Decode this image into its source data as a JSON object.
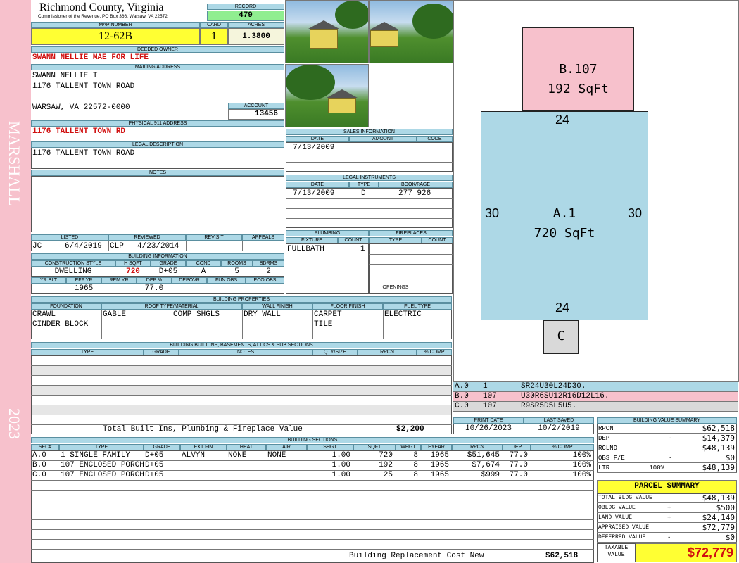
{
  "sidebar": {
    "district": "MARSHALL",
    "year": "2023"
  },
  "header": {
    "county": "Richmond County, Virginia",
    "office": "Commissioner of the Revenue, PO Box 366, Warsaw, VA 22572"
  },
  "record": {
    "label": "RECORD",
    "value": "479"
  },
  "map": {
    "label": "MAP NUMBER",
    "value": "12-62B"
  },
  "card": {
    "label": "CARD",
    "value": "1"
  },
  "acres": {
    "label": "ACRES",
    "value": "1.3800"
  },
  "owner": {
    "label": "DEEDED OWNER",
    "value": "SWANN NELLIE MAE FOR LIFE"
  },
  "mailing": {
    "label": "MAILING ADDRESS",
    "line1": "SWANN NELLIE T",
    "line2": "1176 TALLENT TOWN ROAD",
    "line3": "WARSAW, VA 22572-0000"
  },
  "account": {
    "label": "ACCOUNT",
    "value": "13456"
  },
  "physical": {
    "label": "PHYSICAL 911 ADDRESS",
    "value": "1176 TALLENT TOWN RD"
  },
  "legal": {
    "label": "LEGAL DESCRIPTION",
    "value": "1176 TALLENT TOWN ROAD"
  },
  "notes": {
    "label": "NOTES"
  },
  "sales": {
    "label": "SALES INFORMATION",
    "cols": [
      "DATE",
      "AMOUNT",
      "CODE"
    ],
    "date": "7/13/2009"
  },
  "instruments": {
    "label": "LEGAL INSTRUMENTS",
    "cols": [
      "DATE",
      "TYPE",
      "BOOK/PAGE"
    ],
    "date": "7/13/2009",
    "type": "D",
    "book": "277 926"
  },
  "listed": {
    "listed_label": "LISTED",
    "reviewed_label": "REVIEWED",
    "revisit_label": "REVISIT",
    "appeals_label": "APPEALS",
    "listed_by": "JC",
    "listed_date": "6/4/2019",
    "reviewed_by": "CLP",
    "reviewed_date": "4/23/2014"
  },
  "plumbing": {
    "label": "PLUMBING",
    "fixture_label": "FIXTURE",
    "count_label": "COUNT",
    "fixture": "FULLBATH",
    "count": "1"
  },
  "fireplaces": {
    "label": "FIREPLACES",
    "type_label": "TYPE",
    "count_label": "COUNT",
    "openings_label": "OPENINGS"
  },
  "building_info": {
    "label": "BUILDING INFORMATION",
    "cols": [
      "CONSTRUCTION STYLE",
      "H SQFT",
      "GRADE",
      "COND",
      "ROOMS",
      "BDRMS"
    ],
    "style": "DWELLING",
    "hsqft": "720",
    "grade": "D+05",
    "cond": "A",
    "rooms": "5",
    "bdrms": "2",
    "cols2": [
      "YR BLT",
      "EFF YR",
      "REM YR",
      "DEP %",
      "DEPOVR",
      "FUN OBS",
      "ECO OBS"
    ],
    "eff_yr": "1965",
    "dep": "77.0"
  },
  "properties": {
    "label": "BUILDING PROPERTIES",
    "cols": [
      "FOUNDATION",
      "ROOF TYPE/MATERIAL",
      "WALL FINISH",
      "FLOOR FINISH",
      "FUEL TYPE"
    ],
    "foundation1": "CRAWL",
    "foundation2": "CINDER BLOCK",
    "roof_type": "GABLE",
    "roof_mat": "COMP SHGLS",
    "wall": "DRY WALL",
    "floor1": "CARPET",
    "floor2": "TILE",
    "fuel": "ELECTRIC"
  },
  "builtins": {
    "label": "BUILDING BUILT INS, BASEMENTS, ATTICS & SUB SECTIONS",
    "cols": [
      "TYPE",
      "GRADE",
      "NOTES",
      "QTY/SIZE",
      "RPCN",
      "% COMP"
    ],
    "total_label": "Total Built Ins, Plumbing & Fireplace Value",
    "total_value": "$2,200"
  },
  "sections": {
    "label": "BUILDING SECTIONS",
    "cols": [
      "SEC#",
      "TYPE",
      "GRADE",
      "EXT FIN",
      "HEAT",
      "AIR",
      "SHGT",
      "SQFT",
      "WHGT",
      "EYEAR",
      "RPCN",
      "DEP",
      "% COMP"
    ],
    "rows": [
      [
        "A.0",
        "1 SINGLE FAMILY",
        "D+05",
        "ALVYN",
        "NONE",
        "NONE",
        "1.00",
        "720",
        "8",
        "1965",
        "$51,645",
        "77.0",
        "100%"
      ],
      [
        "B.0",
        "107 ENCLOSED PORCH",
        "D+05",
        "",
        "",
        "",
        "1.00",
        "192",
        "8",
        "1965",
        "$7,674",
        "77.0",
        "100%"
      ],
      [
        "C.0",
        "107 ENCLOSED PORCH",
        "D+05",
        "",
        "",
        "",
        "1.00",
        "25",
        "8",
        "1965",
        "$999",
        "77.0",
        "100%"
      ]
    ],
    "total_label": "Building Replacement Cost New",
    "total_value": "$62,518"
  },
  "sketch": {
    "b_label": "B.107",
    "b_area": "192 SqFt",
    "a_label": "A.1",
    "a_area": "720 SqFt",
    "c_label": "C",
    "top": "24",
    "bottom": "24",
    "left": "30",
    "right": "30"
  },
  "codes": [
    {
      "sec": "A.0",
      "num": "1",
      "code": "SR24U30L24D30.",
      "color": "#add8e6"
    },
    {
      "sec": "B.0",
      "num": "107",
      "code": "U30R6SU12R16D12L16.",
      "color": "#f7c1cc"
    },
    {
      "sec": "C.0",
      "num": "107",
      "code": "R9SR5D5L5U5.",
      "color": "#d9d9d9"
    }
  ],
  "dates": {
    "print_label": "PRINT DATE",
    "saved_label": "LAST SAVED",
    "print": "10/26/2023",
    "saved": "10/2/2019"
  },
  "value_summary": {
    "label": "BUILDING VALUE SUMMARY",
    "rpcn_label": "RPCN",
    "rpcn": "$62,518",
    "dep_label": "DEP",
    "dep_sign": "-",
    "dep": "$14,379",
    "rclnd_label": "RCLND",
    "rclnd": "$48,139",
    "obs_label": "OBS F/E",
    "obs_sign": "-",
    "obs": "$0",
    "ltr_label": "LTR",
    "ltr_pct": "100%",
    "ltr": "$48,139"
  },
  "parcel": {
    "label": "PARCEL SUMMARY",
    "total_bldg_label": "TOTAL BLDG VALUE",
    "total_bldg": "$48,139",
    "obldg_label": "OBLDG VALUE",
    "obldg_sign": "+",
    "obldg": "$500",
    "land_label": "LAND VALUE",
    "land_sign": "+",
    "land": "$24,140",
    "appraised_label": "APPRAISED VALUE",
    "appraised": "$72,779",
    "deferred_label": "DEFERRED VALUE",
    "deferred_sign": "-",
    "deferred": "$0",
    "taxable_label1": "TAXABLE",
    "taxable_label2": "VALUE",
    "taxable": "$72,779"
  }
}
